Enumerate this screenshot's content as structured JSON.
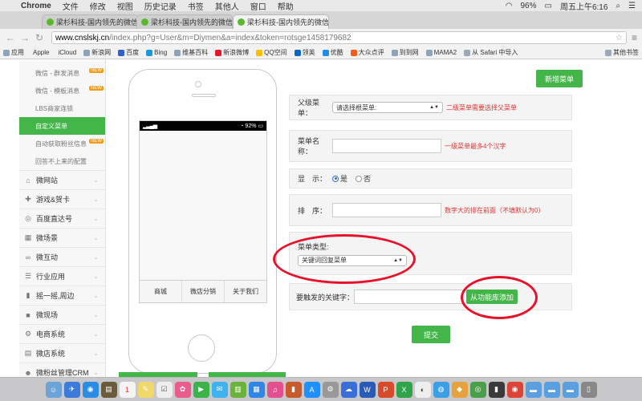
{
  "menubar": {
    "app": "Chrome",
    "items": [
      "文件",
      "修改",
      "视图",
      "历史记录",
      "书签",
      "其他人",
      "窗口",
      "帮助"
    ],
    "battery": "96%",
    "clock": "周五上午6:16"
  },
  "tabs": [
    {
      "title": "梁杉科技-国内领先的微信公众",
      "active": false
    },
    {
      "title": "梁杉科技-国内领先的微信公众",
      "active": false
    },
    {
      "title": "梁杉科技-国内领先的微信公众",
      "active": true
    }
  ],
  "toolbar": {
    "url_host": "www.cnslskj.cn",
    "url_path": "/index.php?g=User&m=Diymen&a=index&token=rotsge1458179682"
  },
  "bookmarks": [
    "应用",
    "Apple",
    "iCloud",
    "新浪网",
    "百度",
    "Bing",
    "维基百科",
    "新浪微博",
    "QQ空间",
    "领英",
    "优酷",
    "大众点评",
    "到到网",
    "MAMA2",
    "从 Safari 中导入",
    "其他书签"
  ],
  "sidebar": {
    "subitems": [
      {
        "label": "微信 - 群发消息",
        "hot": "NEW"
      },
      {
        "label": "微信 - 模板消息",
        "hot": "NEW"
      },
      {
        "label": "LBS商家连锁",
        "hot": ""
      },
      {
        "label": "自定义菜单",
        "hot": "",
        "active": true
      },
      {
        "label": "自动获取粉丝信息",
        "hot": "NEW"
      },
      {
        "label": "回答不上来的配置",
        "hot": ""
      }
    ],
    "categories": [
      {
        "label": "微网站",
        "icon": "home-icon"
      },
      {
        "label": "游戏&贺卡",
        "icon": "gamepad-icon"
      },
      {
        "label": "百度直达号",
        "icon": "baidu-icon"
      },
      {
        "label": "微场景",
        "icon": "grid-icon"
      },
      {
        "label": "微互动",
        "icon": "link-icon"
      },
      {
        "label": "行业应用",
        "icon": "list-icon"
      },
      {
        "label": "摇一摇,周边",
        "icon": "phone-icon"
      },
      {
        "label": "微现场",
        "icon": "video-icon"
      },
      {
        "label": "电商系统",
        "icon": "gear-icon"
      },
      {
        "label": "微店系统",
        "icon": "store-icon"
      },
      {
        "label": "微粉丝管理CRM",
        "icon": "people-icon"
      }
    ]
  },
  "phone": {
    "battery": "92%",
    "menu": [
      "商城",
      "微店分销",
      "关于我们"
    ]
  },
  "form": {
    "add_button": "新增菜单",
    "parent_label": "父级菜单：",
    "parent_select": "请选择根菜单:",
    "parent_hint": "二级菜单需要选择父菜单",
    "name_label": "菜单名称：",
    "name_value": "",
    "name_hint": "一级菜单最多4个汉字",
    "display_label": "显　示：",
    "display_yes": "是",
    "display_no": "否",
    "display_selected": "是",
    "order_label": "排　序：",
    "order_value": "",
    "order_hint": "数字大的排在前面（不填默认为0）",
    "type_label": "菜单类型:",
    "type_select": "关键词回复菜单",
    "keyword_label": "要触发的关键字：",
    "keyword_value": "",
    "keyword_button": "从功能库添加",
    "submit": "提交"
  },
  "annotation_color": "#e8112a",
  "accent_color": "#44b549"
}
